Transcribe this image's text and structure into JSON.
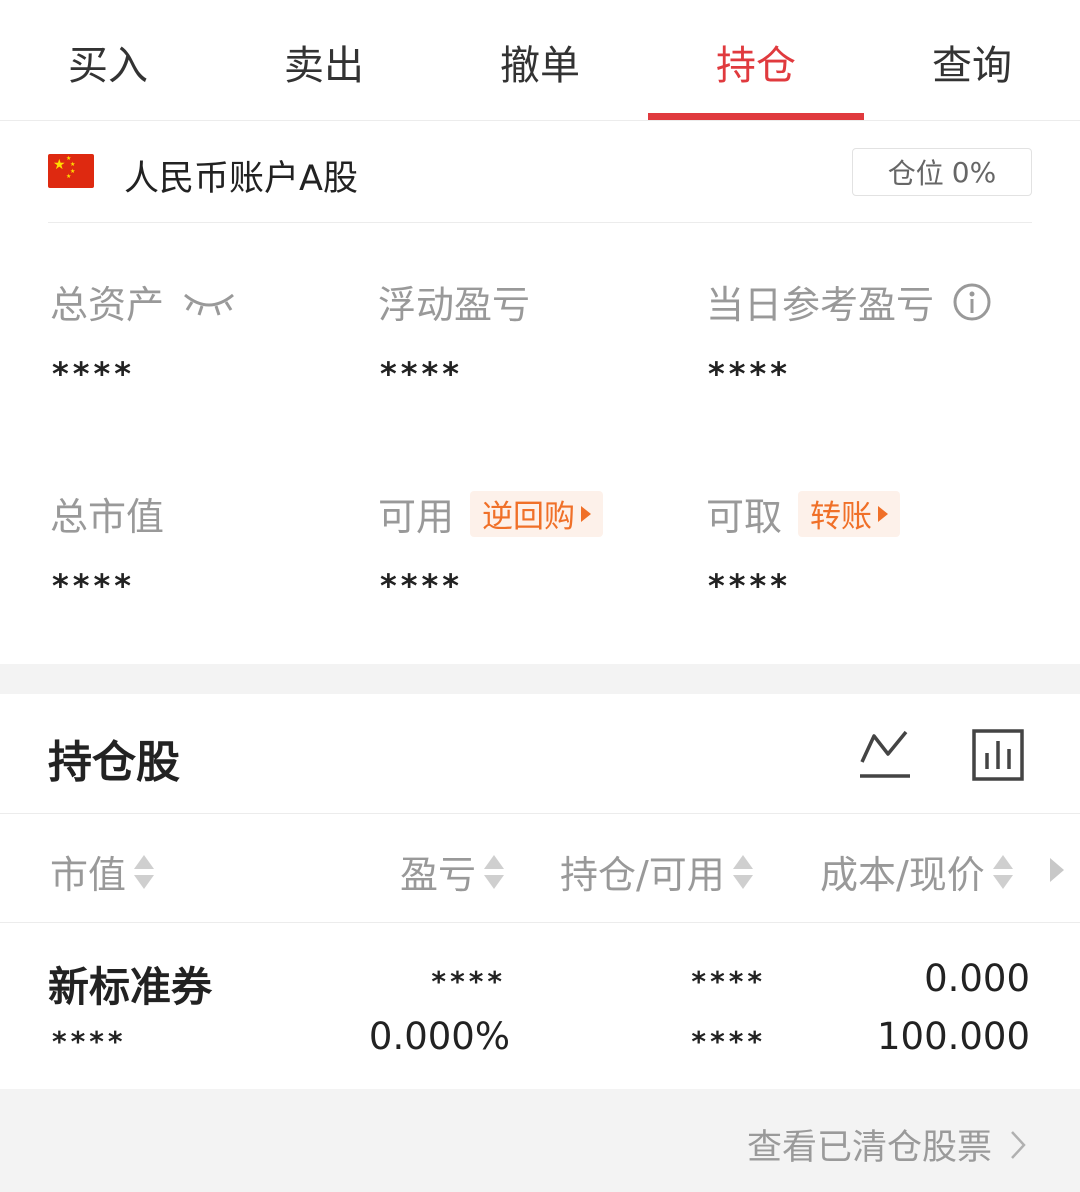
{
  "tabs": [
    {
      "label": "买入"
    },
    {
      "label": "卖出"
    },
    {
      "label": "撤单"
    },
    {
      "label": "持仓"
    },
    {
      "label": "查询"
    }
  ],
  "active_tab": "持仓",
  "account": {
    "name": "人民币账户A股",
    "position_label": "仓位",
    "position_value": "0%"
  },
  "stats": {
    "total_assets": {
      "label": "总资产",
      "value": "****"
    },
    "floating_pl": {
      "label": "浮动盈亏",
      "value": "****"
    },
    "daily_pl": {
      "label": "当日参考盈亏",
      "value": "****"
    },
    "market_value": {
      "label": "总市值",
      "value": "****"
    },
    "available": {
      "label": "可用",
      "value": "****",
      "action": "逆回购"
    },
    "withdrawable": {
      "label": "可取",
      "value": "****",
      "action": "转账"
    }
  },
  "holdings": {
    "title": "持仓股",
    "columns": [
      "市值",
      "盈亏",
      "持仓/可用",
      "成本/现价"
    ],
    "rows": [
      {
        "name": "新标准券",
        "market_value": "****",
        "pl": "****",
        "pl_pct": "0.000%",
        "holding": "****",
        "available": "****",
        "cost": "0.000",
        "price": "100.000"
      }
    ]
  },
  "footer": {
    "link": "查看已清仓股票"
  },
  "colors": {
    "accent": "#e03a3e",
    "tag_text": "#f07028",
    "tag_bg": "#fdf1ea",
    "muted": "#999999"
  },
  "icons": [
    "eye-closed-icon",
    "info-icon",
    "line-chart-icon",
    "bar-chart-icon",
    "chevron-right-icon",
    "china-flag-icon"
  ]
}
